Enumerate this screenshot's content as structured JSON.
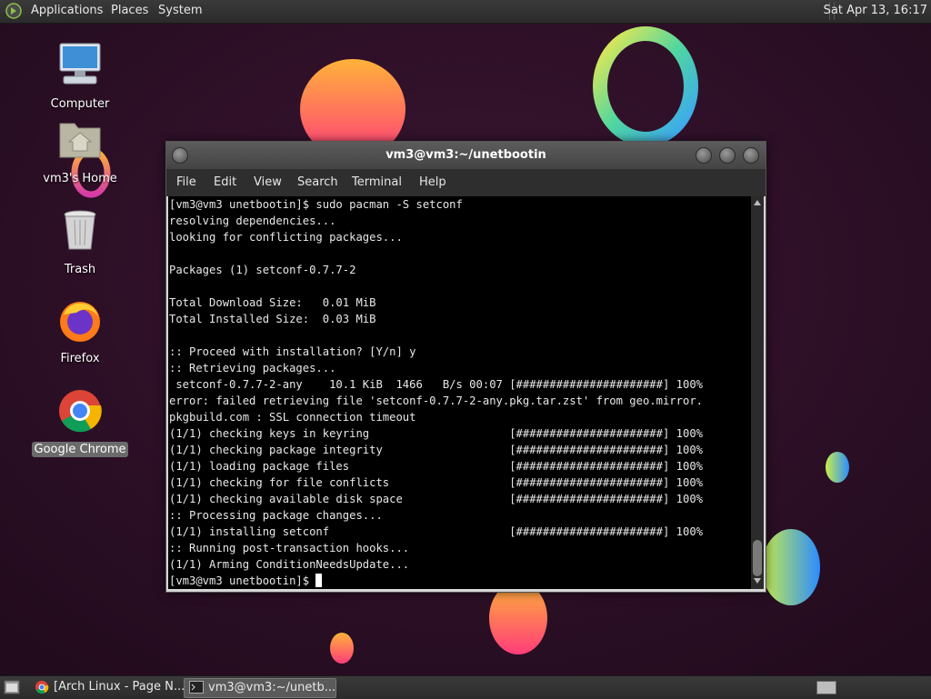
{
  "top_panel": {
    "menus": [
      "Applications",
      "Places",
      "System"
    ],
    "clock": "Sat Apr 13, 16:17"
  },
  "desktop": {
    "icons": [
      {
        "label": "Computer",
        "icon": "computer-icon"
      },
      {
        "label": "vm3's Home",
        "icon": "home-folder-icon"
      },
      {
        "label": "Trash",
        "icon": "trash-icon"
      },
      {
        "label": "Firefox",
        "icon": "firefox-icon"
      },
      {
        "label": "Google Chrome",
        "icon": "chrome-icon",
        "selected": true
      }
    ]
  },
  "terminal": {
    "title": "vm3@vm3:~/unetbootin",
    "menu": [
      "File",
      "Edit",
      "View",
      "Search",
      "Terminal",
      "Help"
    ],
    "lines": [
      "[vm3@vm3 unetbootin]$ sudo pacman -S setconf",
      "resolving dependencies...",
      "looking for conflicting packages...",
      "",
      "Packages (1) setconf-0.7.7-2",
      "",
      "Total Download Size:   0.01 MiB",
      "Total Installed Size:  0.03 MiB",
      "",
      ":: Proceed with installation? [Y/n] y",
      ":: Retrieving packages...",
      " setconf-0.7.7-2-any    10.1 KiB  1466   B/s 00:07 [######################] 100%",
      "error: failed retrieving file 'setconf-0.7.7-2-any.pkg.tar.zst' from geo.mirror.",
      "pkgbuild.com : SSL connection timeout",
      "(1/1) checking keys in keyring                     [######################] 100%",
      "(1/1) checking package integrity                   [######################] 100%",
      "(1/1) loading package files                        [######################] 100%",
      "(1/1) checking for file conflicts                  [######################] 100%",
      "(1/1) checking available disk space                [######################] 100%",
      ":: Processing package changes...",
      "(1/1) installing setconf                           [######################] 100%",
      ":: Running post-transaction hooks...",
      "(1/1) Arming ConditionNeedsUpdate..."
    ],
    "prompt": "[vm3@vm3 unetbootin]$ "
  },
  "taskbar": {
    "tasks": [
      {
        "label": "[Arch Linux - Page N...",
        "icon": "chrome-icon",
        "active": false
      },
      {
        "label": "vm3@vm3:~/unetb...",
        "icon": "terminal-icon",
        "active": true
      }
    ]
  },
  "colors": {
    "background": "#2a1024",
    "panel": "#333333",
    "terminal_bg": "#000000",
    "terminal_fg": "#e8e8e8"
  }
}
